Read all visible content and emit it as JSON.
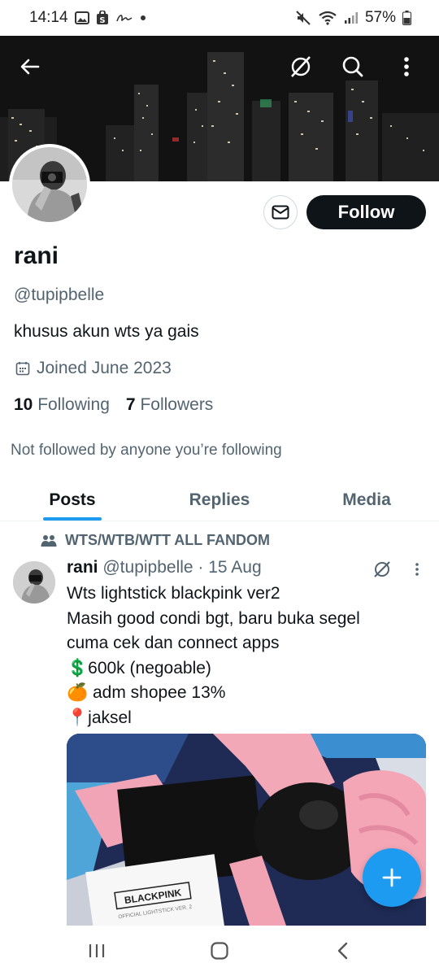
{
  "status_bar": {
    "time": "14:14",
    "battery": "57%",
    "icons": [
      "gallery-icon",
      "shop-icon",
      "signature-icon",
      "dot-icon",
      "mute-icon",
      "wifi-icon",
      "signal-icon",
      "battery-icon"
    ]
  },
  "header": {
    "icons": [
      "back-arrow-icon",
      "grok-icon",
      "search-icon",
      "more-vertical-icon"
    ]
  },
  "profile": {
    "display_name": "rani",
    "handle": "@tupipbelle",
    "bio": "khusus akun wts ya gais",
    "joined": "Joined June 2023",
    "following_count": "10",
    "following_label": "Following",
    "followers_count": "7",
    "followers_label": "Followers",
    "not_followed_note": "Not followed by anyone you’re following",
    "follow_label": "Follow"
  },
  "tabs": [
    {
      "label": "Posts",
      "active": true
    },
    {
      "label": "Replies",
      "active": false
    },
    {
      "label": "Media",
      "active": false
    }
  ],
  "post": {
    "community": "WTS/WTB/WTT ALL FANDOM",
    "author": "rani",
    "meta": "@tupipbelle · 15 Aug",
    "lines": [
      "Wts lightstick blackpink ver2",
      "Masih good condi bgt, baru buka segel",
      "cuma cek dan connect apps",
      "💲600k (negoable)",
      "🍊 adm shopee 13%",
      "📍jaksel"
    ],
    "image_texts": {
      "brand": "BLACKPINK",
      "subtitle": "OFFICIAL LIGHTSTICK VER. 2"
    }
  },
  "colors": {
    "accent": "#1d9bf0",
    "text": "#0f1419",
    "secondary": "#536471",
    "follow_bg": "#0f1419"
  }
}
